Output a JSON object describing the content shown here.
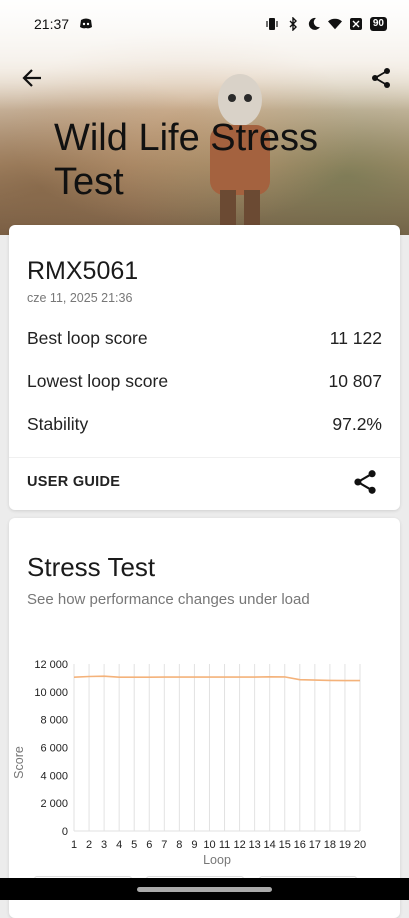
{
  "status_bar": {
    "time": "21:37",
    "battery": "90"
  },
  "header": {
    "title": "Wild Life Stress Test"
  },
  "result": {
    "device": "RMX5061",
    "date": "cze 11, 2025 21:36",
    "rows": [
      {
        "label": "Best loop score",
        "value": "11 122"
      },
      {
        "label": "Lowest loop score",
        "value": "10 807"
      },
      {
        "label": "Stability",
        "value": "97.2%"
      }
    ],
    "user_guide": "USER GUIDE"
  },
  "stress": {
    "title": "Stress Test",
    "subtitle": "See how performance changes under load"
  },
  "chart_data": {
    "type": "line",
    "x": [
      1,
      2,
      3,
      4,
      5,
      6,
      7,
      8,
      9,
      10,
      11,
      12,
      13,
      14,
      15,
      16,
      17,
      18,
      19,
      20
    ],
    "series": [
      {
        "values": [
          11050,
          11100,
          11122,
          11050,
          11050,
          11050,
          11060,
          11060,
          11060,
          11060,
          11060,
          11060,
          11060,
          11080,
          11070,
          10870,
          10840,
          10820,
          10810,
          10807
        ]
      }
    ],
    "xlabel": "Loop",
    "ylabel": "Score",
    "ylim": [
      0,
      12000
    ],
    "yticks": [
      "0",
      "2 000",
      "4 000",
      "6 000",
      "8 000",
      "10 000",
      "12 000"
    ],
    "xticks": [
      "1",
      "2",
      "3",
      "4",
      "5",
      "6",
      "7",
      "8",
      "9",
      "10",
      "11",
      "12",
      "13",
      "14",
      "15",
      "16",
      "17",
      "18",
      "19",
      "20"
    ],
    "grid": "vertical",
    "line_color": "#f4b27a"
  }
}
